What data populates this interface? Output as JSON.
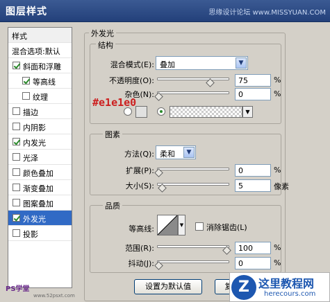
{
  "window": {
    "title": "图层样式",
    "watermark": "思缘设计论坛 www.MISSYUAN.COM"
  },
  "list": {
    "header": "样式",
    "blend_options": "混合选项:默认",
    "items": [
      {
        "label": "斜面和浮雕",
        "checked": true
      },
      {
        "label": "等高线",
        "checked": true
      },
      {
        "label": "纹理",
        "checked": false
      },
      {
        "label": "描边",
        "checked": false
      },
      {
        "label": "内阴影",
        "checked": false
      },
      {
        "label": "内发光",
        "checked": true
      },
      {
        "label": "光泽",
        "checked": false
      },
      {
        "label": "颜色叠加",
        "checked": false
      },
      {
        "label": "渐变叠加",
        "checked": false
      },
      {
        "label": "图案叠加",
        "checked": false
      },
      {
        "label": "外发光",
        "checked": true,
        "selected": true
      },
      {
        "label": "投影",
        "checked": false
      }
    ]
  },
  "panel": {
    "title": "外发光",
    "structure": {
      "title": "结构",
      "blend_label": "混合模式(E):",
      "blend_value": "叠加",
      "opacity_label": "不透明度(O):",
      "opacity_value": "75",
      "noise_label": "杂色(N):",
      "noise_value": "0",
      "percent": "%",
      "color_annotation": "#e1e1e0",
      "color_annotation_hex": "#cc1f1f",
      "swatch_color": "#e1e1e0"
    },
    "elements": {
      "title": "图素",
      "method_label": "方法(Q):",
      "method_value": "柔和",
      "spread_label": "扩展(P):",
      "spread_value": "0",
      "size_label": "大小(S):",
      "size_value": "5",
      "size_unit": "像素",
      "percent": "%"
    },
    "quality": {
      "title": "品质",
      "contour_label": "等高线:",
      "antialias_label": "消除锯齿(L)",
      "range_label": "范围(R):",
      "range_value": "100",
      "jitter_label": "抖动(J):",
      "jitter_value": "0",
      "percent": "%"
    }
  },
  "buttons": {
    "default_label": "设置为默认值",
    "reset_label": "复"
  },
  "watermarks": {
    "ps_text": "PS学堂",
    "ps_url": "www.52psxt.com",
    "site_title": "这里教程网",
    "site_url": "herecours.com"
  },
  "slider_levels": {
    "opacity": 0.75,
    "noise": 0,
    "spread": 0,
    "size": 0.05,
    "range": 1.0,
    "jitter": 0
  }
}
